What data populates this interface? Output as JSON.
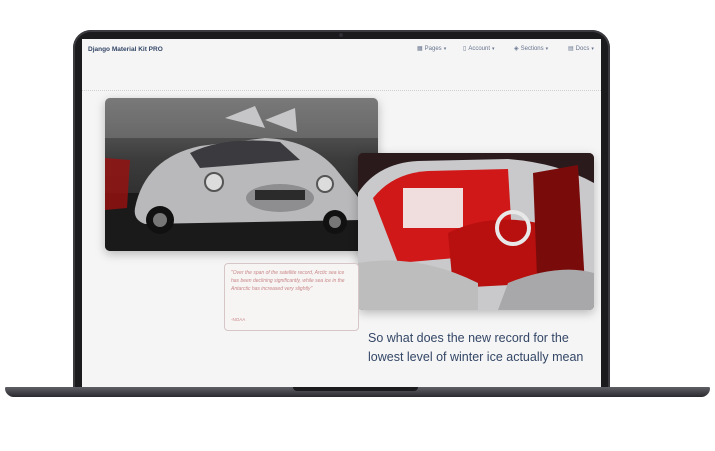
{
  "navbar": {
    "brand": "Django Material Kit PRO",
    "items": [
      {
        "label": "Pages",
        "icon": "grid-icon"
      },
      {
        "label": "Account",
        "icon": "user-icon"
      },
      {
        "label": "Sections",
        "icon": "layers-icon"
      },
      {
        "label": "Docs",
        "icon": "file-icon"
      }
    ]
  },
  "article": {
    "quote": "\"Over the span of the satellite record, Arctic sea ice has been declining significantly, while sea ice in the Antarctic has increased very slightly\"",
    "quote_source": "-NOAA",
    "headline": "So what does the new record for the lowest level of winter ice actually mean"
  }
}
